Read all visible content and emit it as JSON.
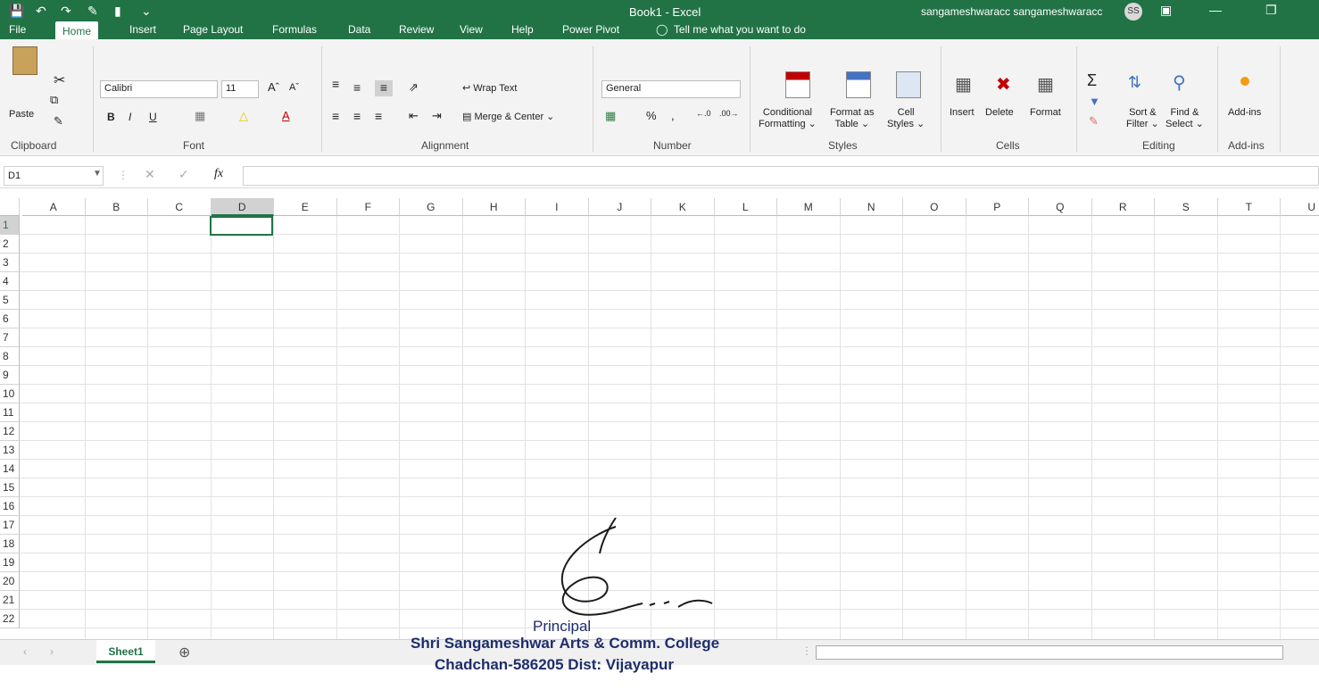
{
  "app": {
    "title": "Book1 - Excel",
    "user": "sangameshwaracc sangameshwaracc",
    "avatar_initials": "SS",
    "accent": "#217346"
  },
  "tabs": [
    "File",
    "Home",
    "Insert",
    "Page Layout",
    "Formulas",
    "Data",
    "Review",
    "View",
    "Help",
    "Power Pivot"
  ],
  "tell_me": "Tell me what you want to do",
  "ribbon": {
    "clipboard": {
      "paste": "Paste",
      "label": "Clipboard"
    },
    "font": {
      "name": "Calibri",
      "size": "11",
      "bold": "B",
      "italic": "I",
      "underline": "U",
      "label": "Font"
    },
    "alignment": {
      "wrap": "Wrap Text",
      "merge": "Merge & Center",
      "label": "Alignment"
    },
    "number": {
      "format": "General",
      "percent": "%",
      "comma": ",",
      "label": "Number"
    },
    "styles": {
      "conditional_1": "Conditional",
      "conditional_2": "Formatting",
      "format_table_1": "Format as",
      "format_table_2": "Table",
      "cell_styles_1": "Cell",
      "cell_styles_2": "Styles",
      "label": "Styles"
    },
    "cells": {
      "insert": "Insert",
      "delete": "Delete",
      "format": "Format",
      "label": "Cells"
    },
    "editing": {
      "sort_1": "Sort &",
      "sort_2": "Filter",
      "find_1": "Find &",
      "find_2": "Select",
      "label": "Editing"
    },
    "addins": {
      "addins": "Add-ins",
      "label": "Add-ins"
    }
  },
  "formula_bar": {
    "name_box": "D1",
    "fx": "fx",
    "value": ""
  },
  "columns": [
    "A",
    "B",
    "C",
    "D",
    "E",
    "F",
    "G",
    "H",
    "I",
    "J",
    "K",
    "L",
    "M",
    "N",
    "O",
    "P",
    "Q",
    "R",
    "S",
    "T",
    "U"
  ],
  "rows": [
    "1",
    "2",
    "3",
    "4",
    "5",
    "6",
    "7",
    "8",
    "9",
    "10",
    "11",
    "12",
    "13",
    "14",
    "15",
    "16",
    "17",
    "18",
    "19",
    "20",
    "21",
    "22"
  ],
  "selected_cell": "D1",
  "sheets": [
    "Sheet1"
  ],
  "stamp": {
    "title": "Principal",
    "line1": "Shri Sangameshwar Arts & Comm. College",
    "line2": "Chadchan-586205 Dist: Vijayapur"
  }
}
